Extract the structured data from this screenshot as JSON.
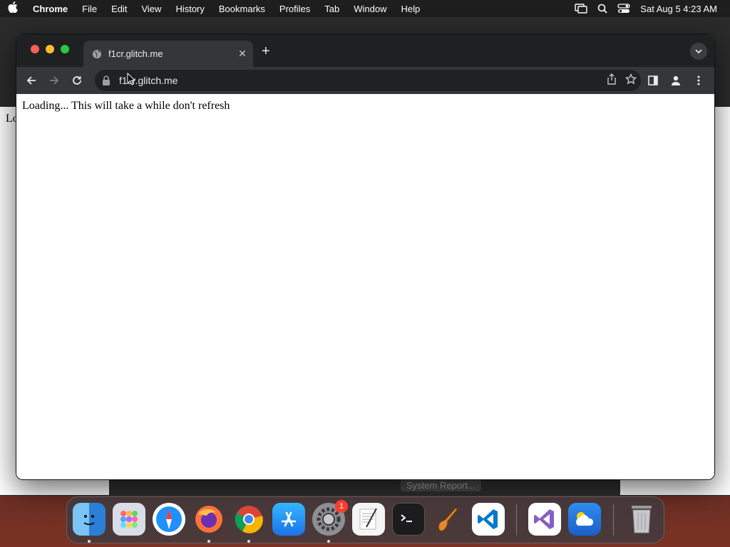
{
  "menubar": {
    "app_name": "Chrome",
    "items": [
      "File",
      "Edit",
      "View",
      "History",
      "Bookmarks",
      "Profiles",
      "Tab",
      "Window",
      "Help"
    ],
    "clock": "Sat Aug 5  4:23 AM"
  },
  "background": {
    "partial_text": "Lo",
    "button_label": "System Report..."
  },
  "chrome": {
    "tab_title": "f1cr.glitch.me",
    "url": "f1cr.glitch.me",
    "page_text": "Loading... This will take a while don't refresh"
  },
  "dock": {
    "apps": [
      "Finder",
      "Launchpad",
      "Safari",
      "Firefox",
      "Chrome",
      "App Store",
      "System Settings",
      "TextEdit",
      "Terminal",
      "GarageBand",
      "Visual Studio Code",
      "Visual Studio",
      "Weather",
      "Trash"
    ],
    "settings_badge": "1"
  },
  "colors": {
    "chrome_dark": "#35363a",
    "tabstrip": "#1f2022",
    "omnibox": "#202124"
  }
}
